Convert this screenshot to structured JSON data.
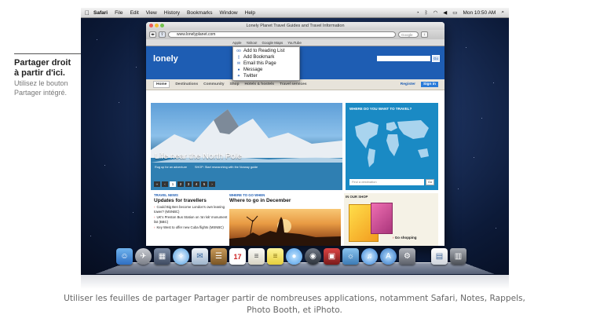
{
  "callout": {
    "title_line1": "Partager droit",
    "title_line2": "à partir d'ici.",
    "body_line1": "Utilisez le bouton",
    "body_line2": "Partager intégré."
  },
  "menubar": {
    "apple": "",
    "items": [
      "Safari",
      "File",
      "Edit",
      "View",
      "History",
      "Bookmarks",
      "Window",
      "Help"
    ],
    "clock": "Mon 10:50 AM"
  },
  "window": {
    "title": "Lonely Planet Travel Guides and Travel Information",
    "address": "www.lonelyplanet.com",
    "search_placeholder": "Google",
    "bookmarks": [
      "Apple",
      "Yahoo!",
      "Google Maps",
      "YouTube"
    ]
  },
  "share_menu": {
    "items": [
      {
        "label": "Add to Reading List",
        "icon": "reading-list-icon"
      },
      {
        "label": "Add Bookmark",
        "icon": "bookmark-icon"
      },
      {
        "label": "Email this Page",
        "icon": "mail-icon"
      },
      {
        "label": "Message",
        "icon": "message-icon"
      },
      {
        "label": "Twitter",
        "icon": "twitter-icon"
      }
    ]
  },
  "site": {
    "logo": "lonely",
    "search_go": "Go",
    "nav": [
      "Home",
      "Destinations",
      "Community",
      "Shop",
      "Hotels & hostels",
      "Travel services"
    ],
    "register": "Register",
    "signin": "Sign in",
    "hero_title": "Life near the North Pole",
    "hero_link1": "Rug up for an adventure",
    "hero_link2": "SHOP: Start researching with the Norway guide",
    "pager": [
      "‹‹",
      "‹",
      "1",
      "2",
      "3",
      "4",
      "5",
      "›"
    ],
    "map_title": "WHERE DO YOU WANT TO TRAVEL?",
    "map_placeholder": "Find a destination",
    "map_go": "Go",
    "news_kicker": "TRAVEL NEWS",
    "news_head": "Updates for travellers",
    "news_items": [
      "Could Big Ben become London's own leaning tower? (MSNBC)",
      "UK's Preston Bus Station on 'at risk' monument list (BBC)",
      "Key West to offer new Cuba flights (MSNBC)"
    ],
    "where_kicker": "WHERE TO GO WHEN",
    "where_head": "Where to go in December",
    "shop_kicker": "IN OUR SHOP",
    "shop_link": "Go shopping"
  },
  "caption": {
    "line1": "Utiliser les feuilles de partager Partager partir de nombreuses applications, notamment Safari, Notes, Rappels,",
    "line2": "Photo Booth, et iPhoto."
  },
  "colors": {
    "lp_blue": "#1e5db3",
    "desktop_dark": "#0c1a38",
    "caption_gray": "#666666"
  }
}
